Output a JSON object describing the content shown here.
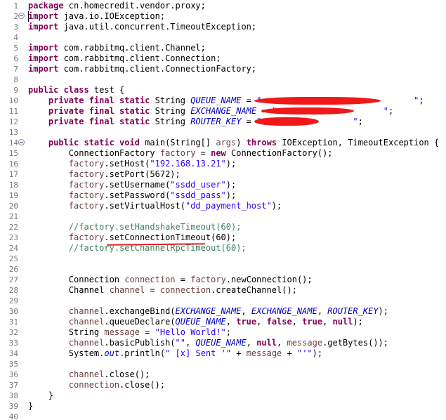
{
  "editor": {
    "lines": [
      {
        "n": "1",
        "tokens": [
          [
            "kw",
            "package"
          ],
          [
            "t",
            " cn.homecredit.vendor.proxy;"
          ]
        ]
      },
      {
        "n": "2",
        "fold": true,
        "tokens": [
          [
            "kw",
            "import"
          ],
          [
            "t",
            " java.io.IOException;"
          ]
        ]
      },
      {
        "n": "3",
        "tokens": [
          [
            "kw",
            "import"
          ],
          [
            "t",
            " java.util.concurrent.TimeoutException;"
          ]
        ]
      },
      {
        "n": "4",
        "tokens": []
      },
      {
        "n": "5",
        "tokens": [
          [
            "kw",
            "import"
          ],
          [
            "t",
            " com.rabbitmq.client.Channel;"
          ]
        ]
      },
      {
        "n": "6",
        "tokens": [
          [
            "kw",
            "import"
          ],
          [
            "t",
            " com.rabbitmq.client.Connection;"
          ]
        ]
      },
      {
        "n": "7",
        "tokens": [
          [
            "kw",
            "import"
          ],
          [
            "t",
            " com.rabbitmq.client.ConnectionFactory;"
          ]
        ]
      },
      {
        "n": "8",
        "tokens": []
      },
      {
        "n": "9",
        "tokens": [
          [
            "kw",
            "public class"
          ],
          [
            "t",
            " test {"
          ]
        ]
      },
      {
        "n": "10",
        "tokens": [
          [
            "t",
            "    "
          ],
          [
            "kw",
            "private final static"
          ],
          [
            "t",
            " String "
          ],
          [
            "fld",
            "QUEUE_NAME"
          ],
          [
            "t",
            " = "
          ],
          [
            "str",
            "\""
          ],
          [
            "t",
            "                              "
          ],
          [
            "str",
            "\""
          ],
          [
            "t",
            ";"
          ]
        ]
      },
      {
        "n": "11",
        "tokens": [
          [
            "t",
            "    "
          ],
          [
            "kw",
            "private final static"
          ],
          [
            "t",
            " String "
          ],
          [
            "fld",
            "EXCHANGE_NAME"
          ],
          [
            "t",
            " = "
          ],
          [
            "str",
            "\""
          ],
          [
            "t",
            "                     "
          ],
          [
            "str",
            "\""
          ],
          [
            "t",
            ";"
          ]
        ]
      },
      {
        "n": "12",
        "tokens": [
          [
            "t",
            "    "
          ],
          [
            "kw",
            "private final static"
          ],
          [
            "t",
            " String "
          ],
          [
            "fld",
            "ROUTER_KEY"
          ],
          [
            "t",
            " = "
          ],
          [
            "str",
            "\""
          ],
          [
            "t",
            "                  "
          ],
          [
            "str",
            "\""
          ],
          [
            "t",
            ";"
          ]
        ]
      },
      {
        "n": "13",
        "tokens": []
      },
      {
        "n": "14",
        "fold": true,
        "tokens": [
          [
            "t",
            "    "
          ],
          [
            "kw",
            "public static void"
          ],
          [
            "t",
            " main(String[] "
          ],
          [
            "var",
            "args"
          ],
          [
            "t",
            ") "
          ],
          [
            "kw",
            "throws"
          ],
          [
            "t",
            " IOException, TimeoutException {"
          ]
        ]
      },
      {
        "n": "15",
        "tokens": [
          [
            "t",
            "        ConnectionFactory "
          ],
          [
            "var",
            "factory"
          ],
          [
            "t",
            " = "
          ],
          [
            "kw",
            "new"
          ],
          [
            "t",
            " ConnectionFactory();"
          ]
        ]
      },
      {
        "n": "16",
        "tokens": [
          [
            "t",
            "        "
          ],
          [
            "var",
            "factory"
          ],
          [
            "t",
            ".setHost("
          ],
          [
            "str",
            "\"192.168.13.21\""
          ],
          [
            "t",
            ");"
          ]
        ]
      },
      {
        "n": "17",
        "tokens": [
          [
            "t",
            "        "
          ],
          [
            "var",
            "factory"
          ],
          [
            "t",
            ".setPort(5672);"
          ]
        ]
      },
      {
        "n": "18",
        "tokens": [
          [
            "t",
            "        "
          ],
          [
            "var",
            "factory"
          ],
          [
            "t",
            ".setUsername("
          ],
          [
            "str",
            "\"ssdd_user\""
          ],
          [
            "t",
            ");"
          ]
        ]
      },
      {
        "n": "19",
        "tokens": [
          [
            "t",
            "        "
          ],
          [
            "var",
            "factory"
          ],
          [
            "t",
            ".setPassword("
          ],
          [
            "str",
            "\"ssdd_pass\""
          ],
          [
            "t",
            ");"
          ]
        ]
      },
      {
        "n": "20",
        "tokens": [
          [
            "t",
            "        "
          ],
          [
            "var",
            "factory"
          ],
          [
            "t",
            ".setVirtualHost("
          ],
          [
            "str",
            "\"dd_payment_host\""
          ],
          [
            "t",
            ");"
          ]
        ]
      },
      {
        "n": "21",
        "tokens": []
      },
      {
        "n": "22",
        "tokens": [
          [
            "t",
            "        "
          ],
          [
            "cmt",
            "//factory.setHandshakeTimeout(60);"
          ]
        ]
      },
      {
        "n": "23",
        "tokens": [
          [
            "t",
            "        "
          ],
          [
            "var",
            "factory"
          ],
          [
            "t",
            ".setConnectionTimeout(60);"
          ]
        ]
      },
      {
        "n": "24",
        "tokens": [
          [
            "t",
            "        "
          ],
          [
            "cmt",
            "//factory.setChannelRpcTimeout(60);"
          ]
        ]
      },
      {
        "n": "25",
        "tokens": []
      },
      {
        "n": "26",
        "tokens": []
      },
      {
        "n": "27",
        "tokens": [
          [
            "t",
            "        Connection "
          ],
          [
            "var",
            "connection"
          ],
          [
            "t",
            " = "
          ],
          [
            "var",
            "factory"
          ],
          [
            "t",
            ".newConnection();"
          ]
        ]
      },
      {
        "n": "28",
        "tokens": [
          [
            "t",
            "        Channel "
          ],
          [
            "var",
            "channel"
          ],
          [
            "t",
            " = "
          ],
          [
            "var",
            "connection"
          ],
          [
            "t",
            ".createChannel();"
          ]
        ]
      },
      {
        "n": "29",
        "tokens": []
      },
      {
        "n": "30",
        "tokens": [
          [
            "t",
            "        "
          ],
          [
            "var",
            "channel"
          ],
          [
            "t",
            ".exchangeBind("
          ],
          [
            "fld",
            "EXCHANGE_NAME"
          ],
          [
            "t",
            ", "
          ],
          [
            "fld",
            "EXCHANGE_NAME"
          ],
          [
            "t",
            ", "
          ],
          [
            "fld",
            "ROUTER_KEY"
          ],
          [
            "t",
            ");"
          ]
        ]
      },
      {
        "n": "31",
        "tokens": [
          [
            "t",
            "        "
          ],
          [
            "var",
            "channel"
          ],
          [
            "t",
            ".queueDeclare("
          ],
          [
            "fld",
            "QUEUE_NAME"
          ],
          [
            "t",
            ", "
          ],
          [
            "kw",
            "true"
          ],
          [
            "t",
            ", "
          ],
          [
            "kw",
            "false"
          ],
          [
            "t",
            ", "
          ],
          [
            "kw",
            "true"
          ],
          [
            "t",
            ", "
          ],
          [
            "kw",
            "null"
          ],
          [
            "t",
            ");"
          ]
        ]
      },
      {
        "n": "32",
        "tokens": [
          [
            "t",
            "        String "
          ],
          [
            "var",
            "message"
          ],
          [
            "t",
            " = "
          ],
          [
            "str",
            "\"Hello World!\""
          ],
          [
            "t",
            ";"
          ]
        ]
      },
      {
        "n": "33",
        "tokens": [
          [
            "t",
            "        "
          ],
          [
            "var",
            "channel"
          ],
          [
            "t",
            ".basicPublish("
          ],
          [
            "str",
            "\"\""
          ],
          [
            "t",
            ", "
          ],
          [
            "fld",
            "QUEUE_NAME"
          ],
          [
            "t",
            ", "
          ],
          [
            "kw",
            "null"
          ],
          [
            "t",
            ", "
          ],
          [
            "var",
            "message"
          ],
          [
            "t",
            ".getBytes());"
          ]
        ]
      },
      {
        "n": "34",
        "tokens": [
          [
            "t",
            "        System."
          ],
          [
            "fld",
            "out"
          ],
          [
            "t",
            ".println("
          ],
          [
            "str",
            "\" [x] Sent '\""
          ],
          [
            "t",
            " + "
          ],
          [
            "var",
            "message"
          ],
          [
            "t",
            " + "
          ],
          [
            "str",
            "\"'\""
          ],
          [
            "t",
            ");"
          ]
        ]
      },
      {
        "n": "35",
        "tokens": []
      },
      {
        "n": "36",
        "tokens": [
          [
            "t",
            "        "
          ],
          [
            "var",
            "channel"
          ],
          [
            "t",
            ".close();"
          ]
        ]
      },
      {
        "n": "37",
        "tokens": [
          [
            "t",
            "        "
          ],
          [
            "var",
            "connection"
          ],
          [
            "t",
            ".close();"
          ]
        ]
      },
      {
        "n": "38",
        "tokens": [
          [
            "t",
            "    }"
          ]
        ]
      },
      {
        "n": "39",
        "tokens": [
          [
            "t",
            "}"
          ]
        ]
      },
      {
        "n": "40",
        "tokens": []
      }
    ]
  },
  "colors": {
    "keyword": "#7f0055",
    "string": "#2a00ff",
    "field": "#0000c0",
    "local_variable": "#6a3e3e",
    "comment": "#3f7f5f",
    "redaction": "#f01818",
    "line_number": "#787878"
  }
}
